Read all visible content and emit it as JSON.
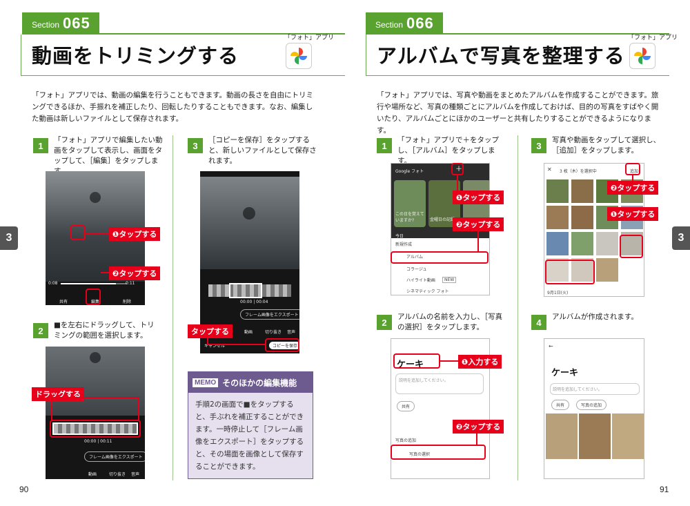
{
  "left": {
    "section_word": "Section",
    "section_number": "065",
    "title": "動画をトリミングする",
    "app_tag": "「フォト」アプリ",
    "intro": "「フォト」アプリでは、動画の編集を行うこともできます。動画の長さを自由にトリミングできるほか、手振れを補正したり、回転したりすることもできます。なお、編集した動画は新しいファイルとして保存されます。",
    "step1": {
      "num": "1",
      "text": "「フォト」アプリで編集したい動画をタップして表示し、画面をタップして、［編集］をタップします。",
      "callout1": "❶タップする",
      "callout2": "❷タップする",
      "time_start": "0:08",
      "time_end": "0:11",
      "btn_share": "共有",
      "btn_edit": "編集",
      "btn_delete": "削除"
    },
    "step2": {
      "num": "2",
      "text": "■を左右にドラッグして、トリミングの範囲を選択します。",
      "callout": "ドラッグする",
      "time": "00:00 | 00:11",
      "export_btn": "フレーム画像をエクスポート",
      "tab_video": "動画",
      "tab_crop": "切り抜き",
      "tab_audio": "音声"
    },
    "step3": {
      "num": "3",
      "text": "［コピーを保存］をタップすると、新しいファイルとして保存されます。",
      "callout": "タップする",
      "time": "00:00 | 00:04",
      "export_btn": "フレーム画像をエクスポート",
      "tab_video": "動画",
      "tab_crop": "切り抜き",
      "tab_audio": "音声",
      "cancel": "キャンセル",
      "save_copy": "コピーを保存"
    },
    "memo": {
      "label": "MEMO",
      "title": "そのほかの編集機能",
      "body": "手順2の画面で■をタップすると、手ぶれを補正することができます。一時停止して［フレーム画像をエクスポート］をタップすると、その場面を画像として保存することができます。"
    },
    "page_number": "90",
    "side_tab": "3"
  },
  "right": {
    "section_word": "Section",
    "section_number": "066",
    "title": "アルバムで写真を整理する",
    "app_tag": "「フォト」アプリ",
    "intro": "「フォト」アプリでは、写真や動画をまとめたアルバムを作成することができます。旅行や場所など、写真の種類ごとにアルバムを作成しておけば、目的の写真をすばやく開いたり、アルバムごとにほかのユーザーと共有したりすることができるようになります。",
    "step1": {
      "num": "1",
      "text": "「フォト」アプリで＋をタップし、［アルバム］をタップします。",
      "app_header": "Google フォト",
      "card1": "この日を覚えていますか?",
      "card2": "金曜日の記録",
      "today": "今日",
      "new_create": "新規作成",
      "menu": [
        "アルバム",
        "コラージュ",
        "ハイライト動画",
        "シネマティック フォト"
      ],
      "new_badge": "NEW",
      "callout1": "❶タップする",
      "callout2": "❷タップする"
    },
    "step2": {
      "num": "2",
      "text": "アルバムの名前を入力し、［写真の選択］をタップします。",
      "album_name": "ケーキ",
      "placeholder": "説明を追加してください。",
      "share": "共有",
      "add_photos_label": "写真の追加",
      "select_photos": "写真の選択",
      "callout1": "❶入力する",
      "callout2": "❷タップする"
    },
    "step3": {
      "num": "3",
      "text": "写真や動画をタップして選択し、［追加］をタップします。",
      "header": "3 枚（木）を選択中",
      "add": "追加",
      "date": "9月1日(火)",
      "callout1": "❷タップする",
      "callout2": "❶タップする"
    },
    "step4": {
      "num": "4",
      "text": "アルバムが作成されます。",
      "album_name": "ケーキ",
      "placeholder": "説明を追加してください。",
      "share": "共有",
      "add_photos": "写真の追加"
    },
    "page_number": "91",
    "side_tab": "3"
  },
  "colors": {
    "green": "#5aa22f",
    "red": "#e8001b",
    "memo_purple": "#6d5a8f",
    "memo_bg": "#e6e0ee"
  }
}
